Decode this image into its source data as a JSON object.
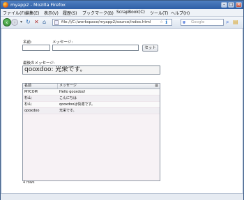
{
  "window": {
    "title": "myapp2 - Mozilla Firefox"
  },
  "menu": {
    "items": [
      "ファイル(F)",
      "編集(E)",
      "表示(V)",
      "履歴(S)",
      "ブックマーク(B)",
      "ScrapBook(C)",
      "ツール(T)",
      "ヘルプ(H)"
    ]
  },
  "nav": {
    "url": "file:///C:/workspace/myapp2/source/index.html",
    "search_placeholder": "Google"
  },
  "form": {
    "name_label": "名前:",
    "message_label": "メッセージ:",
    "set_button": "セット",
    "name_value": "",
    "message_value": ""
  },
  "latest": {
    "label": "最後のメッセージ:",
    "value": "qooxdoo: 光栄です。"
  },
  "table": {
    "columns": [
      "名前",
      "メッセージ"
    ],
    "rows": [
      [
        "MYCOM",
        "Hello qooxdoo!"
      ],
      [
        "杉山",
        "こんにちは"
      ],
      [
        "杉山",
        "qooxdooは快適です。"
      ],
      [
        "qooxdoo",
        "光栄です。"
      ]
    ],
    "footer": "4 rows"
  }
}
